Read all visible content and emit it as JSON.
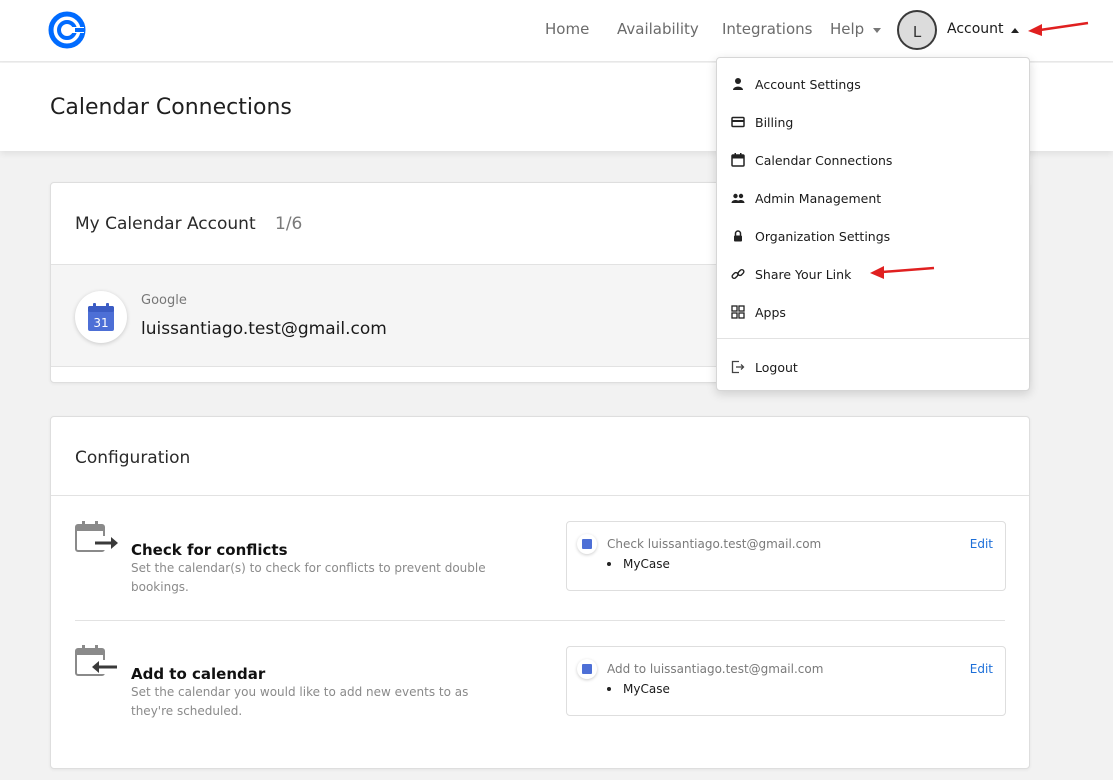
{
  "colors": {
    "brand": "#006bff",
    "link": "#1d6fd8",
    "annotation": "#e02020",
    "gcal_blue": "#4d6fd6"
  },
  "nav": {
    "home": "Home",
    "availability": "Availability",
    "integrations": "Integrations",
    "help": "Help",
    "avatar_initial": "L",
    "account": "Account"
  },
  "page": {
    "title": "Calendar Connections"
  },
  "calendar_account": {
    "title": "My Calendar Account",
    "count": "1/6",
    "provider": "Google",
    "email": "luissantiago.test@gmail.com",
    "icon_day": "31"
  },
  "configuration": {
    "title": "Configuration",
    "conflicts": {
      "title": "Check for conflicts",
      "description": "Set the calendar(s) to check for conflicts to prevent double bookings.",
      "box_text": "Check luissantiago.test@gmail.com",
      "calendar": "MyCase",
      "edit": "Edit"
    },
    "add": {
      "title": "Add to calendar",
      "description": "Set the calendar you would like to add new events to as they're scheduled.",
      "box_text": "Add to luissantiago.test@gmail.com",
      "calendar": "MyCase",
      "edit": "Edit"
    }
  },
  "dropdown": {
    "items": [
      {
        "label": "Account Settings",
        "icon": "person-icon"
      },
      {
        "label": "Billing",
        "icon": "credit-card-icon"
      },
      {
        "label": "Calendar Connections",
        "icon": "calendar-icon"
      },
      {
        "label": "Admin Management",
        "icon": "people-icon"
      },
      {
        "label": "Organization Settings",
        "icon": "lock-icon"
      },
      {
        "label": "Share Your Link",
        "icon": "link-icon"
      },
      {
        "label": "Apps",
        "icon": "apps-grid-icon"
      }
    ],
    "logout": {
      "label": "Logout",
      "icon": "logout-icon"
    }
  }
}
